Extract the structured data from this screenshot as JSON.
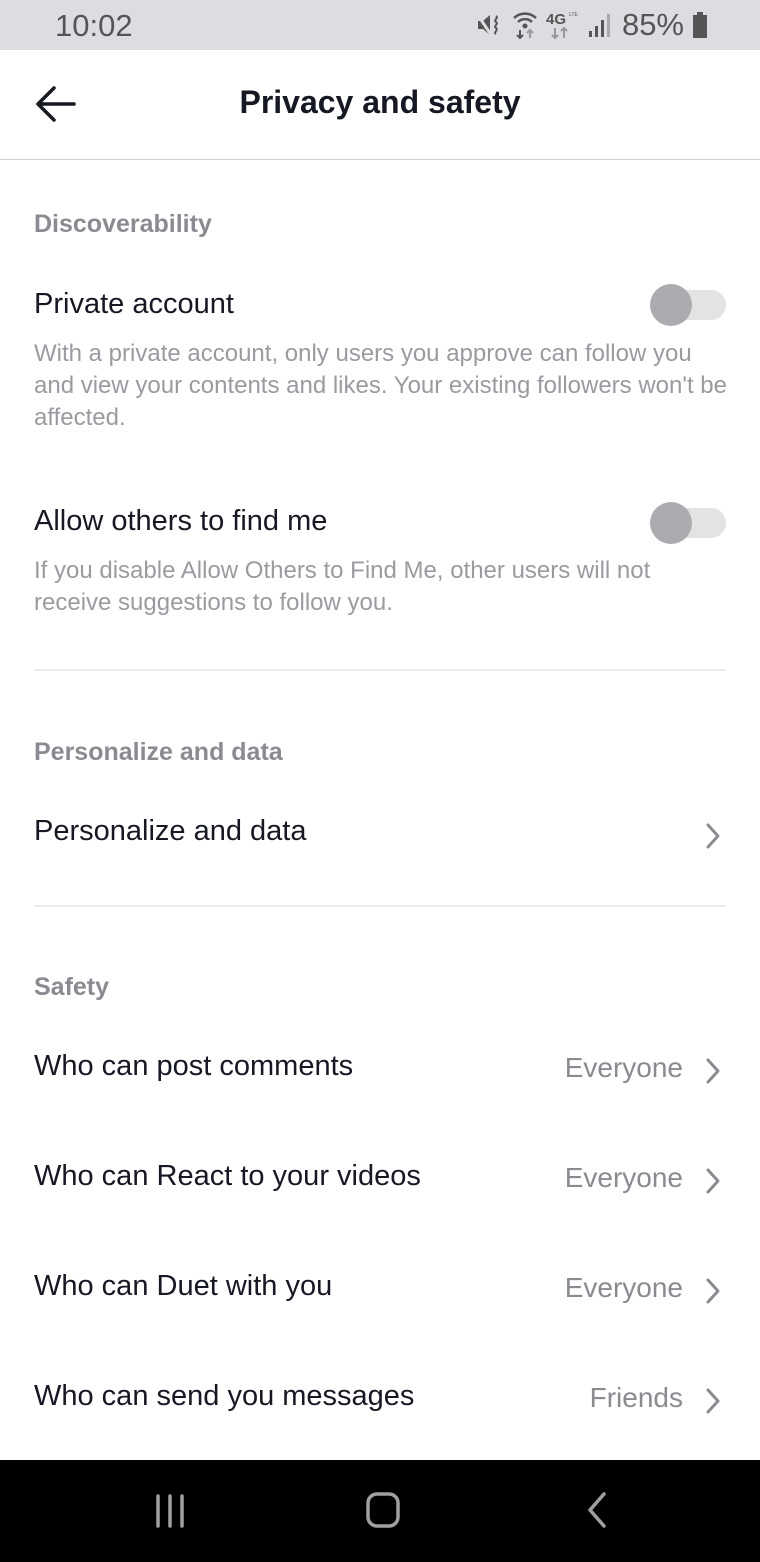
{
  "status_bar": {
    "time": "10:02",
    "network_label": "4G LTE",
    "battery_percent": "85%",
    "icons": [
      "vibrate-icon",
      "wifi-icon",
      "lte-icon",
      "signal-icon",
      "battery-icon"
    ]
  },
  "header": {
    "title": "Privacy and safety",
    "back_icon": "arrow-left-icon"
  },
  "sections": {
    "discoverability": {
      "label": "Discoverability",
      "private_account": {
        "title": "Private account",
        "description": "With a private account, only users you approve can follow you and view your contents and likes. Your existing followers won't be affected.",
        "enabled": false
      },
      "find_me": {
        "title": "Allow others to find me",
        "description": "If you disable Allow Others to Find Me, other users will not receive suggestions to follow you.",
        "enabled": false
      }
    },
    "personalize": {
      "label": "Personalize and data",
      "item": {
        "title": "Personalize and data"
      }
    },
    "safety": {
      "label": "Safety",
      "items": [
        {
          "title": "Who can post comments",
          "value": "Everyone"
        },
        {
          "title": "Who can React to your videos",
          "value": "Everyone"
        },
        {
          "title": "Who can Duet with you",
          "value": "Everyone"
        },
        {
          "title": "Who can send you messages",
          "value": "Friends"
        }
      ]
    }
  },
  "colors": {
    "primary_text": "#161823",
    "secondary_text": "#8a8b91",
    "toggle_off_knob": "#acabb0",
    "toggle_off_track": "#e3e3e4"
  },
  "system_nav": {
    "buttons": [
      "recents-icon",
      "home-icon",
      "back-icon"
    ]
  }
}
